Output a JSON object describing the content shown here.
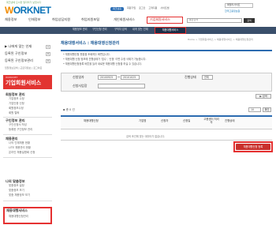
{
  "header": {
    "tagline": "워크넷에 오시면 일자리가 보입니다",
    "logo_prefix": "W",
    "logo_rest": "ORKNET",
    "top_links": [
      "워크넷홈",
      "회원가입",
      "로그인",
      "고객지원",
      "사이트맵"
    ],
    "lang_select": "패밀리사이트",
    "corp_label": "한국고용정보원",
    "nav": [
      "채용정보",
      "인재정보",
      "취업상담지원",
      "취업지원포털",
      "개인회원서비스"
    ],
    "nav_active": "기업회원서비스",
    "search_placeholder": "통합검색",
    "search_button": "검색"
  },
  "subnav": {
    "items": [
      "채용정보 관리",
      "구인신청 관리",
      "구직자 검색",
      "내게 맞는 인재"
    ],
    "active": "채용대행서비스"
  },
  "sidebar": {
    "util": [
      {
        "label": "▶ 나에게 맞는 인재",
        "btn": "+"
      },
      {
        "label": "등록된 구인정보",
        "btn": "0"
      },
      {
        "label": "등록된 구인정보관리",
        "btn": "0"
      }
    ],
    "links": "입찰정보검색 | 근로자정보 | 로그아웃",
    "head_small": "WORKNET",
    "head_title": "기업회원서비스",
    "sections": [
      {
        "title": "회원정보 관리",
        "items": [
          "기업정보 수정",
          "기업인증 신청",
          "회원정보수정",
          "회원 탈퇴"
        ]
      },
      {
        "title": "구인정보 관리",
        "items": [
          "구인신청서 작성",
          "등록한 구인정보 관리"
        ]
      },
      {
        "title": "채용관리",
        "items": [
          "나의 인재채용 현황",
          "LITE 채용관리 현황",
          "온라인 채용설명회 신청"
        ]
      },
      {
        "title": "나의 맞춤정보",
        "items": [
          "맞춤정보 설정",
          "맞춤정보 보기",
          "맞춤 채용정보 보기"
        ]
      },
      {
        "title": "채용대행서비스",
        "items": [
          "채용대행신청관리"
        ]
      }
    ]
  },
  "content": {
    "breadcrumb": "Home > 기업회원서비스 > 채용대행서비스 > 채용대행신청관리",
    "title": "채용대행서비스 : 채용대행신청관리",
    "bullets": [
      "• 채용대행신청 현황을 조회하는 화면입니다.",
      "• 채용대행 신청 정보에 진행상태가 '접수', '신청' 이면 수정 삭제가 가능합니다.",
      "• 채용대행신청등록 버튼을 눌러 새로운 채용대행 신청을 하실 수 있습니다."
    ],
    "form": {
      "date_label": "신청일자",
      "date_from": "20100925",
      "date_to": "20101025",
      "status_label": "진행상태",
      "status_value": "전체",
      "company_label": "신청사업장",
      "search_button": "▶ 검색"
    },
    "total": "▪ 총 0 건",
    "per_page": "10",
    "per_page_button": "확인",
    "columns": [
      "채용대행신청",
      "기업명",
      "신청자",
      "신청일",
      "고용센터 처리자",
      "진행상태"
    ],
    "empty": "검색 조건에 맞는 데이터가 없습니다.",
    "register_button": "채용대행신청 등록"
  }
}
